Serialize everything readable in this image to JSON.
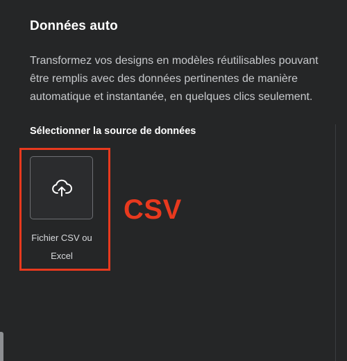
{
  "panel": {
    "title": "Données auto",
    "description": "Transformez vos designs en modèles réutilisables pouvant être remplis avec des données pertinentes de manière automatique et instantanée, en quelques clics seulement."
  },
  "source_section": {
    "heading": "Sélectionner la source de données",
    "options": [
      {
        "label": "Fichier CSV ou Excel",
        "icon": "cloud-upload-icon"
      }
    ]
  },
  "annotation": {
    "text": "CSV",
    "color": "#e8391e"
  },
  "colors": {
    "background": "#252627",
    "text_primary": "#ffffff",
    "text_secondary": "#c8cacd",
    "card_border": "#6e7074",
    "highlight": "#e8391e"
  }
}
